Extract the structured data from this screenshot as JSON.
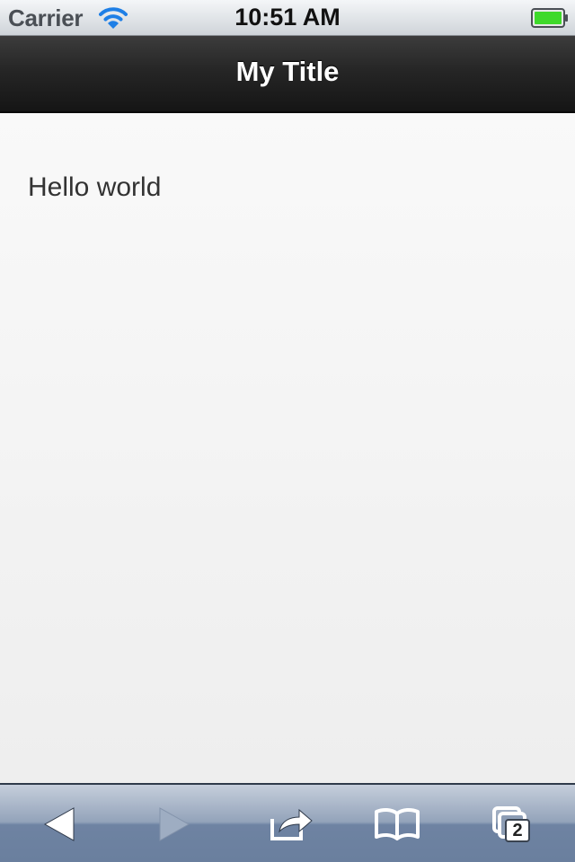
{
  "status_bar": {
    "carrier": "Carrier",
    "time": "10:51 AM",
    "wifi_icon": "wifi-icon",
    "battery_icon": "battery-icon",
    "battery_color": "#3ed92a"
  },
  "header": {
    "title": "My Title"
  },
  "content": {
    "text": "Hello world"
  },
  "toolbar": {
    "back_icon": "back-arrow-icon",
    "forward_icon": "forward-arrow-icon",
    "share_icon": "share-icon",
    "bookmarks_icon": "bookmarks-icon",
    "tabs_icon": "tabs-icon",
    "tab_count": "2"
  }
}
